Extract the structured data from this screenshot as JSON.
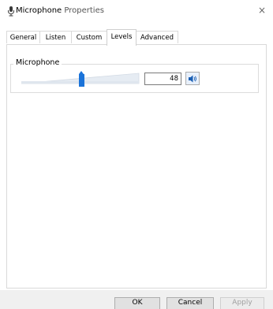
{
  "window": {
    "title_main": "Microphone",
    "title_rest": " Properties",
    "close_glyph": "×"
  },
  "tabs": [
    {
      "label": "General"
    },
    {
      "label": "Listen"
    },
    {
      "label": "Custom"
    },
    {
      "label": "Levels",
      "active": true
    },
    {
      "label": "Advanced"
    }
  ],
  "levels": {
    "group_label": "Microphone",
    "level_value": "48",
    "slider_value": 48,
    "slider_max": 100,
    "accent": "#1a73d9"
  },
  "buttons": {
    "ok": "OK",
    "cancel": "Cancel",
    "apply": "Apply"
  }
}
